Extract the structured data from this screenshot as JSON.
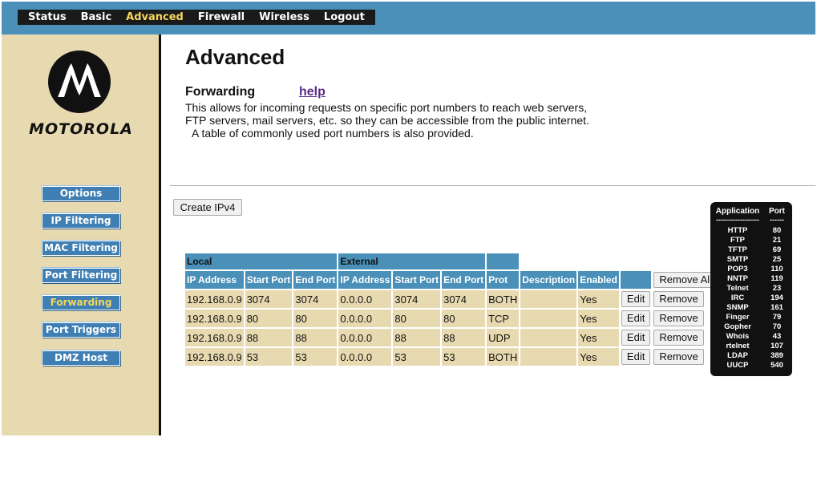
{
  "nav": {
    "items": [
      {
        "label": "Status",
        "active": false
      },
      {
        "label": "Basic",
        "active": false
      },
      {
        "label": "Advanced",
        "active": true
      },
      {
        "label": "Firewall",
        "active": false
      },
      {
        "label": "Wireless",
        "active": false
      },
      {
        "label": "Logout",
        "active": false
      }
    ]
  },
  "brand": {
    "logo_text": "MOTOROLA"
  },
  "sidebar": {
    "items": [
      {
        "label": "Options",
        "active": false
      },
      {
        "label": "IP Filtering",
        "active": false
      },
      {
        "label": "MAC Filtering",
        "active": false
      },
      {
        "label": "Port Filtering",
        "active": false
      },
      {
        "label": "Forwarding",
        "active": true
      },
      {
        "label": "Port Triggers",
        "active": false
      },
      {
        "label": "DMZ Host",
        "active": false
      }
    ]
  },
  "main": {
    "title": "Advanced",
    "section_title": "Forwarding",
    "help_label": "help",
    "desc_line1": "This allows for incoming requests on specific port numbers to reach  web servers,",
    "desc_line2": "FTP servers, mail servers, etc. so they can be accessible from the public internet.",
    "desc_line3": "A table of commonly used port numbers is also provided.",
    "create_button": "Create IPv4"
  },
  "table": {
    "group_local": "Local",
    "group_external": "External",
    "headers": [
      "IP Address",
      "Start Port",
      "End Port",
      "IP Address",
      "Start Port",
      "End Port",
      "Prot",
      "Description",
      "Enabled"
    ],
    "remove_all_label": "Remove All",
    "edit_label": "Edit",
    "remove_label": "Remove",
    "rows": [
      {
        "local_ip": "192.168.0.9",
        "local_start": "3074",
        "local_end": "3074",
        "ext_ip": "0.0.0.0",
        "ext_start": "3074",
        "ext_end": "3074",
        "prot": "BOTH",
        "description": "",
        "enabled": "Yes"
      },
      {
        "local_ip": "192.168.0.9",
        "local_start": "80",
        "local_end": "80",
        "ext_ip": "0.0.0.0",
        "ext_start": "80",
        "ext_end": "80",
        "prot": "TCP",
        "description": "",
        "enabled": "Yes"
      },
      {
        "local_ip": "192.168.0.9",
        "local_start": "88",
        "local_end": "88",
        "ext_ip": "0.0.0.0",
        "ext_start": "88",
        "ext_end": "88",
        "prot": "UDP",
        "description": "",
        "enabled": "Yes"
      },
      {
        "local_ip": "192.168.0.9",
        "local_start": "53",
        "local_end": "53",
        "ext_ip": "0.0.0.0",
        "ext_start": "53",
        "ext_end": "53",
        "prot": "BOTH",
        "description": "",
        "enabled": "Yes"
      }
    ]
  },
  "port_reference": {
    "header_app": "Application",
    "header_port": "Port",
    "dash_app": "------------------",
    "dash_port": "------",
    "rows": [
      {
        "app": "HTTP",
        "port": "80"
      },
      {
        "app": "FTP",
        "port": "21"
      },
      {
        "app": "TFTP",
        "port": "69"
      },
      {
        "app": "SMTP",
        "port": "25"
      },
      {
        "app": "POP3",
        "port": "110"
      },
      {
        "app": "NNTP",
        "port": "119"
      },
      {
        "app": "Telnet",
        "port": "23"
      },
      {
        "app": "IRC",
        "port": "194"
      },
      {
        "app": "SNMP",
        "port": "161"
      },
      {
        "app": "Finger",
        "port": "79"
      },
      {
        "app": "Gopher",
        "port": "70"
      },
      {
        "app": "Whois",
        "port": "43"
      },
      {
        "app": "rtelnet",
        "port": "107"
      },
      {
        "app": "LDAP",
        "port": "389"
      },
      {
        "app": "UUCP",
        "port": "540"
      }
    ]
  },
  "colors": {
    "header_blue": "#4a90b8",
    "sidebar_tan": "#e8dab0",
    "active_yellow": "#f6d75c",
    "button_blue": "#3f7fb3"
  }
}
